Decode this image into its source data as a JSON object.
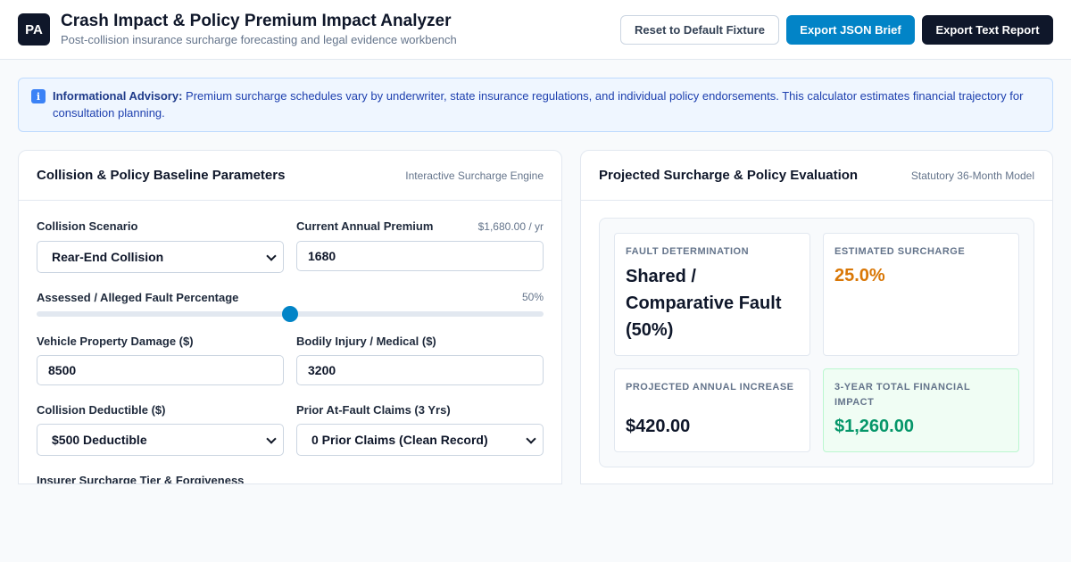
{
  "header": {
    "logo_text": "PA",
    "title": "Crash Impact & Policy Premium Impact Analyzer",
    "subtitle": "Post-collision insurance surcharge forecasting and legal evidence workbench",
    "buttons": {
      "reset": "Reset to Default Fixture",
      "export_json": "Export JSON Brief",
      "export_text": "Export Text Report"
    }
  },
  "advisory": {
    "icon": "info-icon",
    "bold": "Informational Advisory:",
    "text": " Premium surcharge schedules vary by underwriter, state insurance regulations, and individual policy endorsements. This calculator estimates financial trajectory for consultation planning."
  },
  "left_panel": {
    "title": "Collision & Policy Baseline Parameters",
    "tag": "Interactive Surcharge Engine",
    "collision_scenario": {
      "label": "Collision Scenario",
      "value": "Rear-End Collision"
    },
    "annual_premium": {
      "label": "Current Annual Premium",
      "hint": "$1,680.00 / yr",
      "value": "1680"
    },
    "fault": {
      "label": "Assessed / Alleged Fault Percentage",
      "value_text": "50%",
      "value_pct": 50
    },
    "property_damage": {
      "label": "Vehicle Property Damage ($)",
      "value": "8500"
    },
    "bodily_injury": {
      "label": "Bodily Injury / Medical ($)",
      "value": "3200"
    },
    "deductible": {
      "label": "Collision Deductible ($)",
      "value": "$500 Deductible"
    },
    "prior_claims": {
      "label": "Prior At-Fault Claims (3 Yrs)",
      "value": "0 Prior Claims (Clean Record)"
    },
    "surcharge_tier": {
      "label": "Insurer Surcharge Tier & Forgiveness"
    }
  },
  "right_panel": {
    "title": "Projected Surcharge & Policy Evaluation",
    "tag": "Statutory 36-Month Model",
    "cards": {
      "fault": {
        "label": "FAULT DETERMINATION",
        "value": "Shared / Comparative Fault (50%)"
      },
      "surcharge": {
        "label": "ESTIMATED SURCHARGE",
        "value": "25.0%"
      },
      "annual": {
        "label": "PROJECTED ANNUAL INCREASE",
        "value": "$420.00"
      },
      "total": {
        "label": "3-YEAR TOTAL FINANCIAL IMPACT",
        "value": "$1,260.00"
      }
    }
  },
  "colors": {
    "primary": "#0284c7",
    "dark": "#0f172a",
    "surcharge": "#d97706",
    "total": "#059669",
    "advisory_bg": "#eff6ff"
  }
}
